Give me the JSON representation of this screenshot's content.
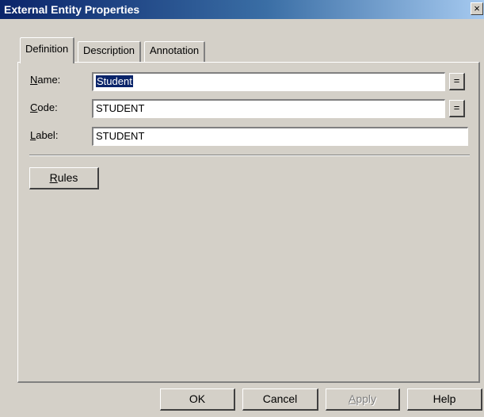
{
  "window": {
    "title": "External Entity Properties",
    "close_glyph": "×"
  },
  "tabs": [
    {
      "label": "Definition",
      "active": true
    },
    {
      "label": "Description",
      "active": false
    },
    {
      "label": "Annotation",
      "active": false
    }
  ],
  "form": {
    "name": {
      "label_mnemonic": "N",
      "label_rest": "ame:",
      "value": "Student",
      "selected": true
    },
    "code": {
      "label_mnemonic": "C",
      "label_rest": "ode:",
      "value": "STUDENT"
    },
    "label": {
      "label_mnemonic": "L",
      "label_rest": "abel:",
      "value": "STUDENT"
    },
    "eq_button_label": "="
  },
  "rules_button": {
    "mnemonic": "R",
    "rest": "ules"
  },
  "footer": {
    "ok": "OK",
    "cancel": "Cancel",
    "apply": {
      "mnemonic": "A",
      "rest": "pply",
      "enabled": false
    },
    "help": "Help"
  },
  "colors": {
    "titlebar_start": "#0a246a",
    "titlebar_end": "#a6caf0",
    "face": "#d4d0c8",
    "selection": "#0a246a"
  }
}
